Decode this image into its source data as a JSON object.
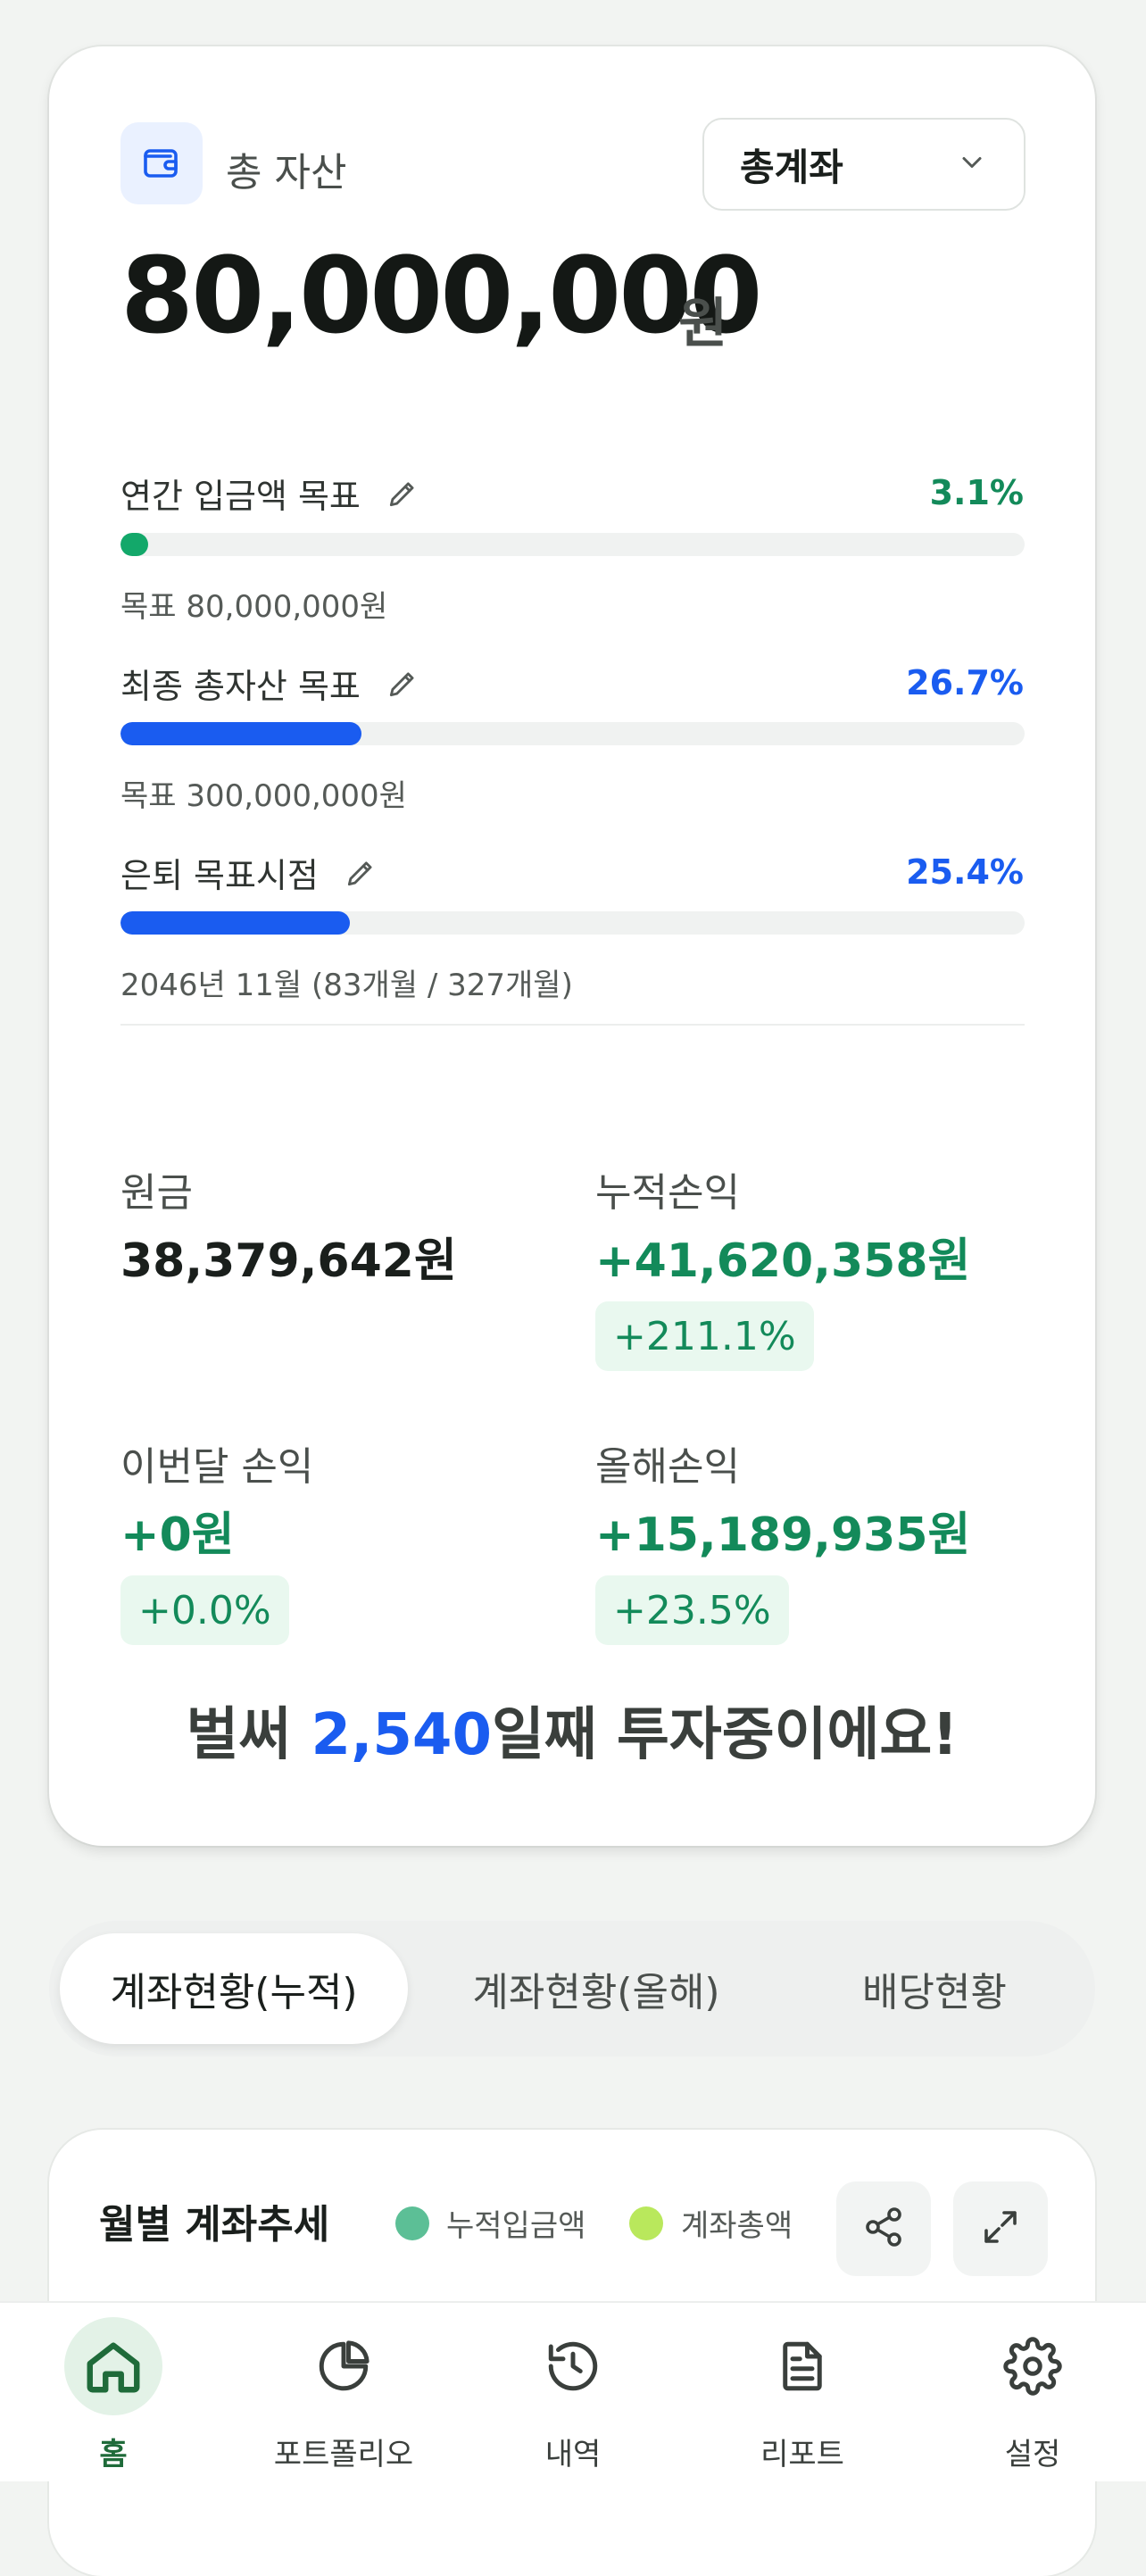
{
  "summary": {
    "total_label": "총 자산",
    "account_select_value": "총계좌",
    "total_amount": "80,000,000",
    "total_unit": "원"
  },
  "goals": [
    {
      "label": "연간 입금액 목표",
      "percent_text": "3.1%",
      "progress": 0.031,
      "sub": "목표 80,000,000원",
      "color": "#13a86a"
    },
    {
      "label": "최종 총자산 목표",
      "percent_text": "26.7%",
      "progress": 0.267,
      "sub": "목표 300,000,000원",
      "color": "#1a5cf0"
    },
    {
      "label": "은퇴 목표시점",
      "percent_text": "25.4%",
      "progress": 0.254,
      "sub": "2046년 11월 (83개월 / 327개월)",
      "color": "#1a5cf0"
    }
  ],
  "stats": {
    "principal_label": "원금",
    "principal_value": "38,379,642원",
    "cumulative_label": "누적손익",
    "cumulative_value": "+41,620,358원",
    "cumulative_pct": "+211.1%",
    "month_label": "이번달 손익",
    "month_value": "+0원",
    "month_pct": "+0.0%",
    "year_label": "올해손익",
    "year_value": "+15,189,935원",
    "year_pct": "+23.5%"
  },
  "invest_message": {
    "prefix": "벌써 ",
    "days": "2,540",
    "suffix": "일째 투자중이에요!"
  },
  "tabs": [
    {
      "label": "계좌현황(누적)",
      "active": true
    },
    {
      "label": "계좌현황(올해)",
      "active": false
    },
    {
      "label": "배당현황",
      "active": false
    }
  ],
  "trend": {
    "title": "월별 계좌추세",
    "legend": [
      {
        "label": "누적입금액",
        "color": "#5cbf96"
      },
      {
        "label": "계좌총액",
        "color": "#b9e85c"
      }
    ]
  },
  "nav": [
    {
      "label": "홈",
      "icon": "home-icon",
      "active": true
    },
    {
      "label": "포트폴리오",
      "icon": "pie-chart-icon",
      "active": false
    },
    {
      "label": "내역",
      "icon": "history-icon",
      "active": false
    },
    {
      "label": "리포트",
      "icon": "document-icon",
      "active": false
    },
    {
      "label": "설정",
      "icon": "gear-icon",
      "active": false
    }
  ],
  "colors": {
    "accent_green": "#138a5a",
    "accent_blue": "#1a5cf0",
    "nav_active": "#1f6b3a"
  }
}
